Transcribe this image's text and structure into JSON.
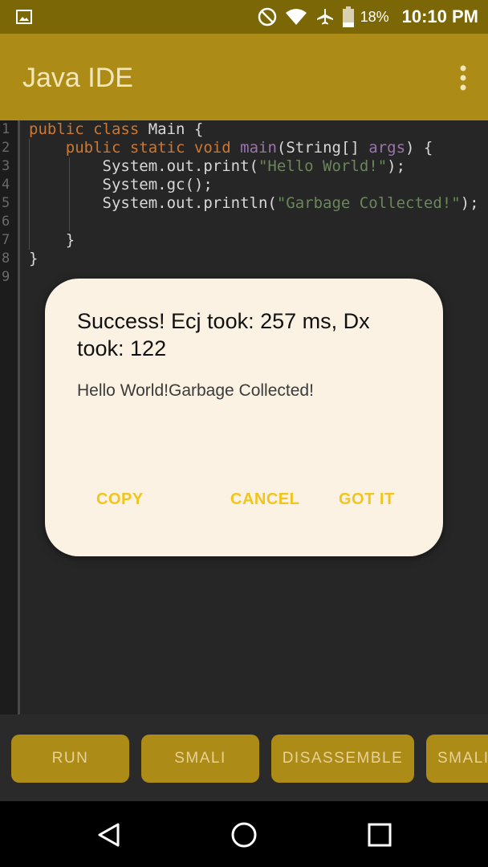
{
  "status_bar": {
    "battery_percent": "18%",
    "time": "10:10 PM",
    "icons": [
      "image-icon",
      "do-not-disturb-icon",
      "wifi-icon",
      "airplane-icon",
      "battery-icon"
    ]
  },
  "app_bar": {
    "title": "Java IDE",
    "menu_icon": "more-vert-icon"
  },
  "editor": {
    "line_numbers": [
      "1",
      "2",
      "3",
      "4",
      "5",
      "6",
      "7",
      "8",
      "9"
    ]
  },
  "dialog": {
    "title": "Success! Ecj took: 257 ms, Dx took: 122",
    "message": "Hello World!Garbage Collected!",
    "buttons": {
      "copy": "COPY",
      "cancel": "CANCEL",
      "ok": "GOT IT"
    }
  },
  "toolbar": {
    "buttons": [
      "RUN",
      "SMALI",
      "DISASSEMBLE",
      "SMALI"
    ]
  },
  "nav_bar": {
    "icons": [
      "back-icon",
      "home-icon",
      "recents-icon"
    ]
  },
  "colors": {
    "status_bar": "#7c6706",
    "app_bar": "#ad8b17",
    "accent": "#f2c51e",
    "editor_bg": "#262626",
    "dialog_bg": "#fbf2e3"
  }
}
